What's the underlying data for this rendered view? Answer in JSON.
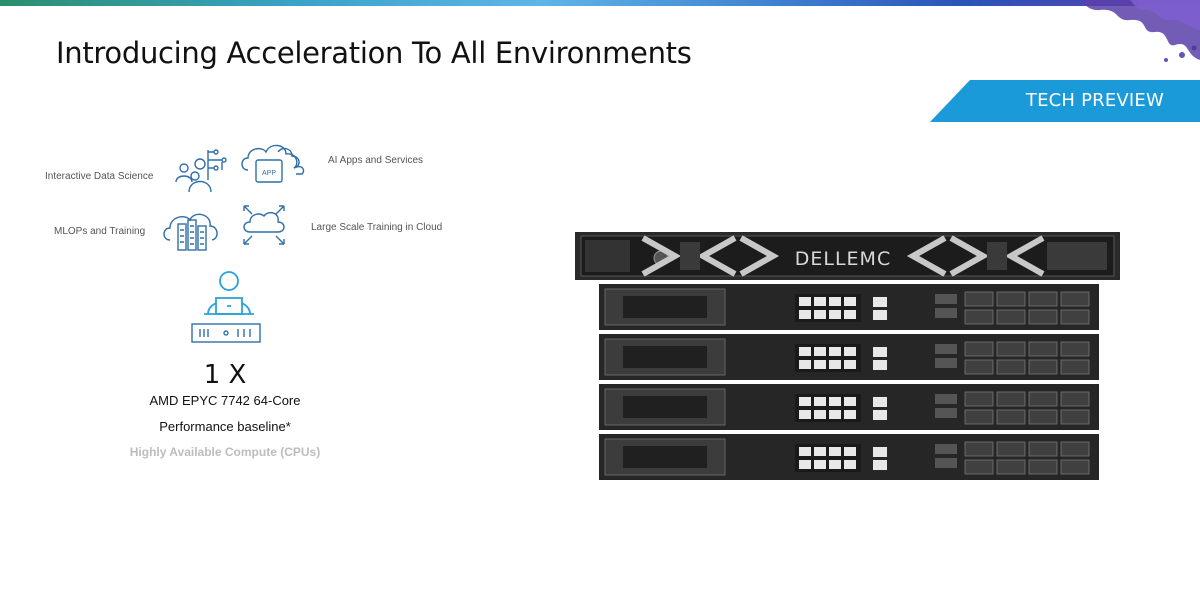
{
  "slide": {
    "title": "Introducing Acceleration To All Environments",
    "badge": "TECH PREVIEW"
  },
  "use_cases": [
    {
      "label": "Interactive Data Science",
      "icon": "data-science-icon"
    },
    {
      "label": "AI Apps and Services",
      "icon": "cloud-app-icon"
    },
    {
      "label": "MLOPs and Training",
      "icon": "cloud-datacenter-icon"
    },
    {
      "label": "Large Scale Training in Cloud",
      "icon": "cloud-scale-icon"
    }
  ],
  "baseline": {
    "multiplier": "1 X",
    "cpu": "AMD EPYC 7742 64-Core",
    "performance": "Performance baseline*",
    "category": "Highly Available Compute (CPUs)"
  },
  "hardware": {
    "brand": "DELLEMC",
    "units": 4
  },
  "colors": {
    "accent": "#1a9ad8",
    "icon": "#2f6fa8",
    "user_icon": "#29a3d8"
  }
}
